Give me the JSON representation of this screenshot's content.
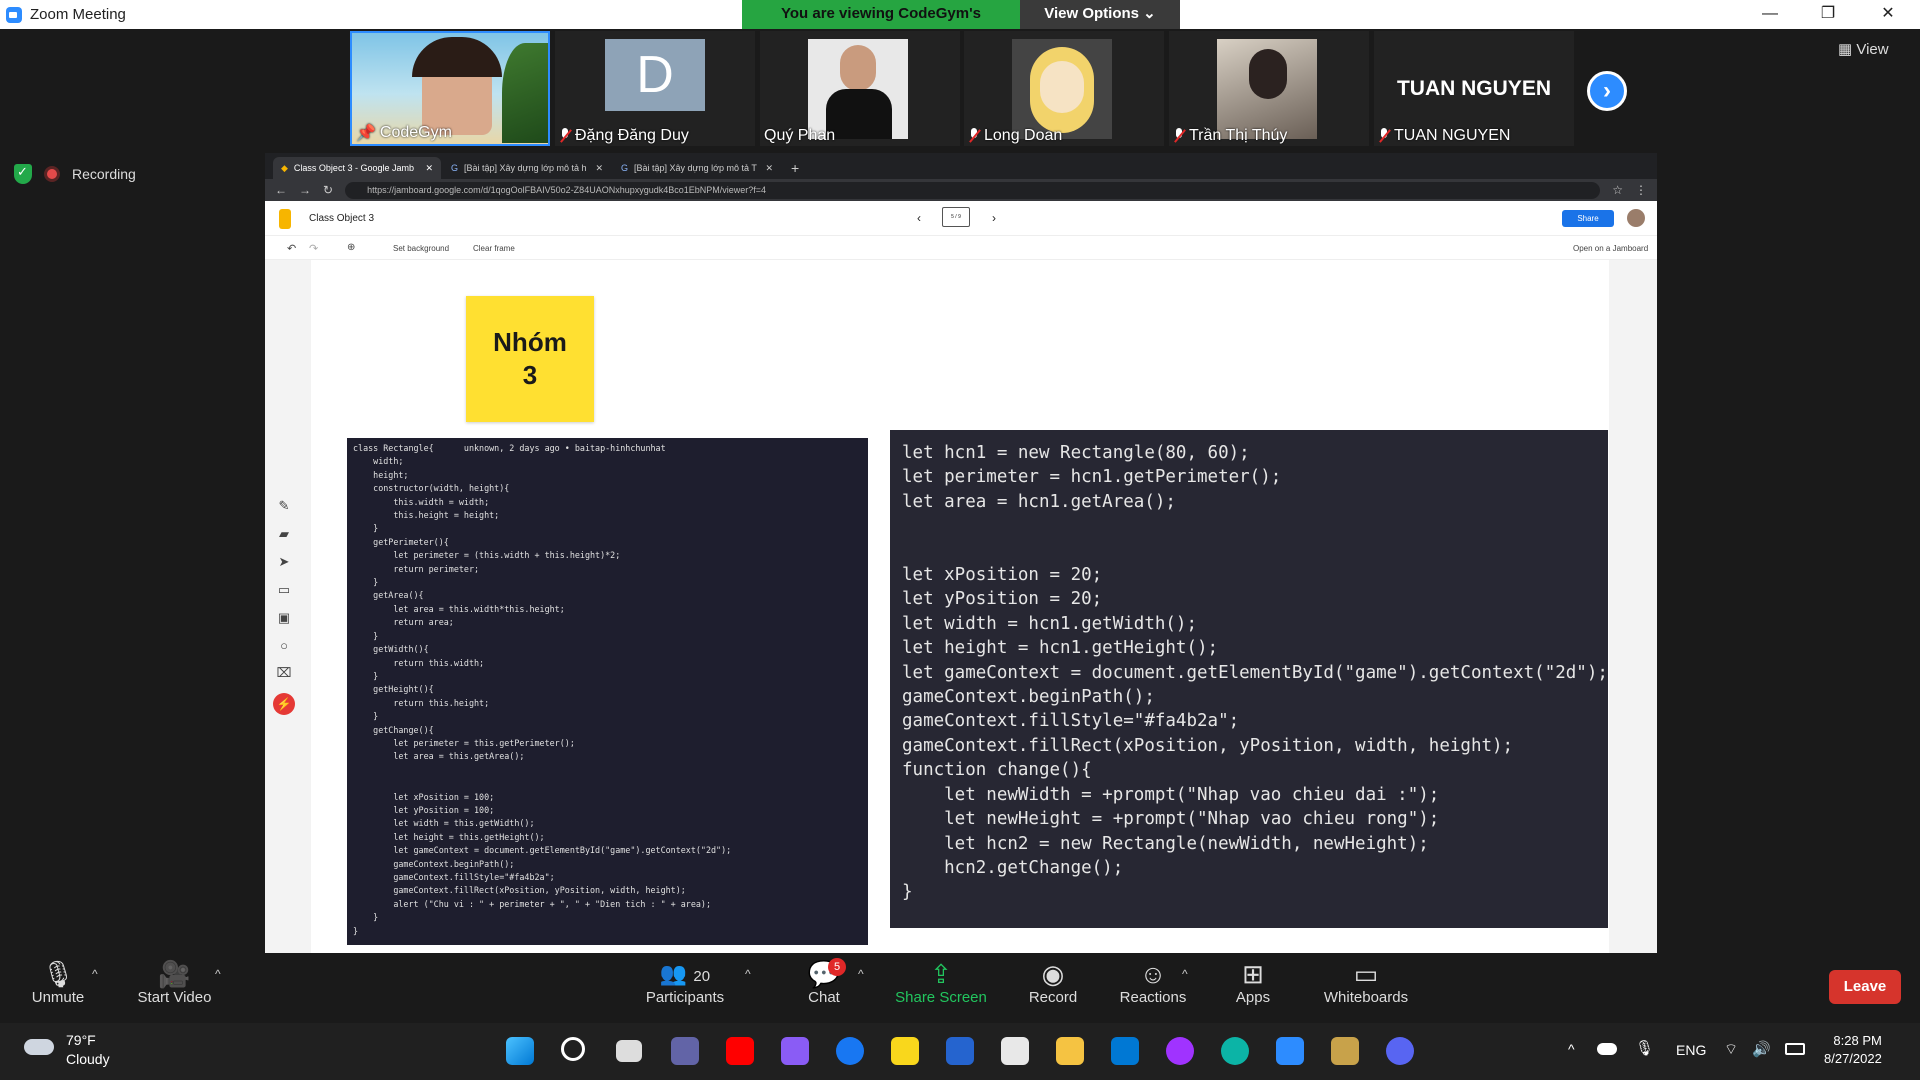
{
  "window": {
    "title": "Zoom Meeting"
  },
  "banner": {
    "viewing": "You are viewing CodeGym's screen",
    "view_options": "View Options"
  },
  "gallery": {
    "view_label": "View",
    "participants": [
      {
        "name": "CodeGym",
        "pinned": true
      },
      {
        "name": "Đặng Đăng Duy",
        "avatar_letter": "D",
        "muted": true
      },
      {
        "name": "Quý Phan"
      },
      {
        "name": "Long Doan",
        "muted": true
      },
      {
        "name": "Trần Thị Thúy",
        "muted": true
      },
      {
        "name": "TUAN NGUYEN",
        "muted": true,
        "big_name": "TUAN NGUYEN"
      }
    ]
  },
  "recording": {
    "label": "Recording"
  },
  "browser": {
    "tabs": [
      {
        "label": "Class Object 3 - Google Jamb"
      },
      {
        "label": "[Bài tập] Xây dựng lớp mô tả h"
      },
      {
        "label": "[Bài tập] Xây dựng lớp mô tả T"
      }
    ],
    "url": "https://jamboard.google.com/d/1qogOolFBAIV50o2-Z84UAONxhupxygudk4Bco1EbNPM/viewer?f=4",
    "url_host": "jamboard.google.com"
  },
  "jamboard": {
    "title": "Class Object 3",
    "frame_counter": "5 / 9",
    "share_label": "Share",
    "set_background": "Set background",
    "clear_frame": "Clear frame",
    "open_on": "Open on a Jamboard",
    "sticky_note": "Nhóm\n3"
  },
  "code_left": "class Rectangle{      unknown, 2 days ago • baitap-hinhchunhat\n    width;\n    height;\n    constructor(width, height){\n        this.width = width;\n        this.height = height;\n    }\n    getPerimeter(){\n        let perimeter = (this.width + this.height)*2;\n        return perimeter;\n    }\n    getArea(){\n        let area = this.width*this.height;\n        return area;\n    }\n    getWidth(){\n        return this.width;\n    }\n    getHeight(){\n        return this.height;\n    }\n    getChange(){\n        let perimeter = this.getPerimeter();\n        let area = this.getArea();\n\n\n        let xPosition = 100;\n        let yPosition = 100;\n        let width = this.getWidth();\n        let height = this.getHeight();\n        let gameContext = document.getElementById(\"game\").getContext(\"2d\");\n        gameContext.beginPath();\n        gameContext.fillStyle=\"#fa4b2a\";\n        gameContext.fillRect(xPosition, yPosition, width, height);\n        alert (\"Chu vi : \" + perimeter + \", \" + \"Dien tich : \" + area);\n    }\n}",
  "code_right": "let hcn1 = new Rectangle(80, 60);\nlet perimeter = hcn1.getPerimeter();\nlet area = hcn1.getArea();\n\n\nlet xPosition = 20;\nlet yPosition = 20;\nlet width = hcn1.getWidth();\nlet height = hcn1.getHeight();\nlet gameContext = document.getElementById(\"game\").getContext(\"2d\");\ngameContext.beginPath();\ngameContext.fillStyle=\"#fa4b2a\";\ngameContext.fillRect(xPosition, yPosition, width, height);\nfunction change(){\n    let newWidth = +prompt(\"Nhap vao chieu dai :\");\n    let newHeight = +prompt(\"Nhap vao chieu rong\");\n    let hcn2 = new Rectangle(newWidth, newHeight);\n    hcn2.getChange();\n}",
  "toolbar": {
    "unmute": "Unmute",
    "start_video": "Start Video",
    "participants": "Participants",
    "participant_count": "20",
    "chat": "Chat",
    "chat_badge": "5",
    "share_screen": "Share Screen",
    "record": "Record",
    "reactions": "Reactions",
    "apps": "Apps",
    "whiteboards": "Whiteboards",
    "leave": "Leave"
  },
  "taskbar": {
    "temperature": "79°F",
    "condition": "Cloudy",
    "language": "ENG",
    "time": "8:28 PM",
    "date": "8/27/2022"
  },
  "colors": {
    "zoom_blue": "#2d8cff",
    "banner_green": "#26a541",
    "leave_red": "#d6342c",
    "sticky_yellow": "#ffe031",
    "share_green": "#22c55e"
  }
}
